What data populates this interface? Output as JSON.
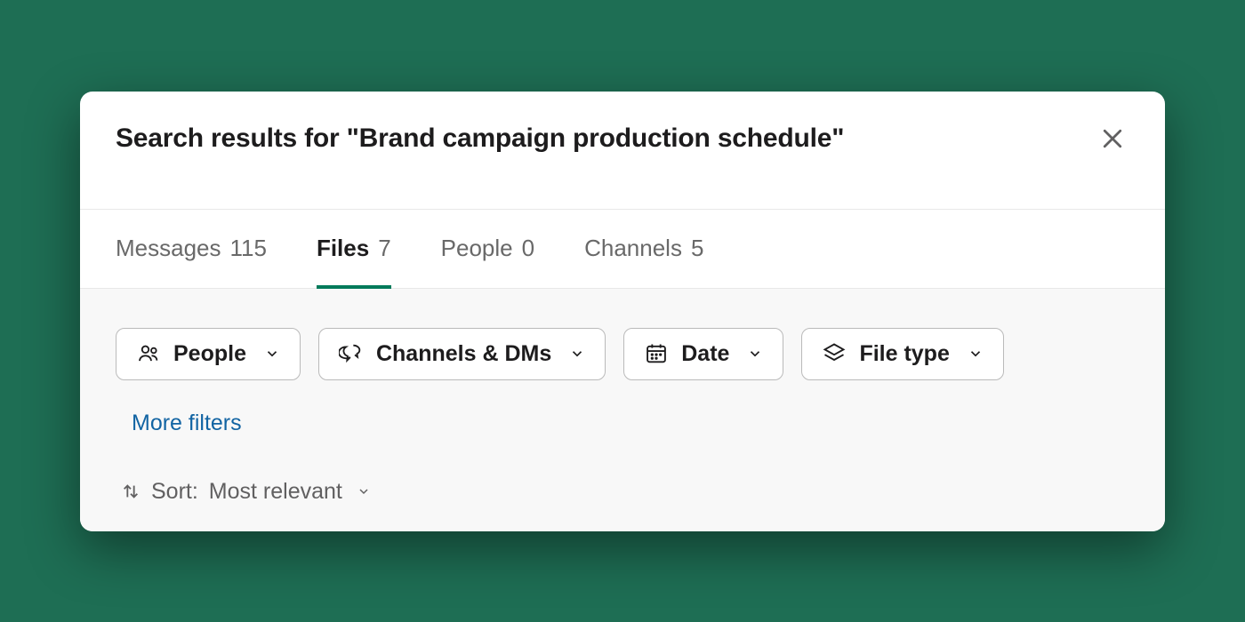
{
  "header": {
    "title": "Search results for \"Brand campaign production schedule\""
  },
  "tabs": [
    {
      "label": "Messages",
      "count": "115",
      "active": false
    },
    {
      "label": "Files",
      "count": "7",
      "active": true
    },
    {
      "label": "People",
      "count": "0",
      "active": false
    },
    {
      "label": "Channels",
      "count": "5",
      "active": false
    }
  ],
  "filters": {
    "people": "People",
    "channels_dms": "Channels & DMs",
    "date": "Date",
    "file_type": "File type",
    "more": "More filters"
  },
  "sort": {
    "prefix": "Sort:",
    "value": "Most relevant"
  }
}
